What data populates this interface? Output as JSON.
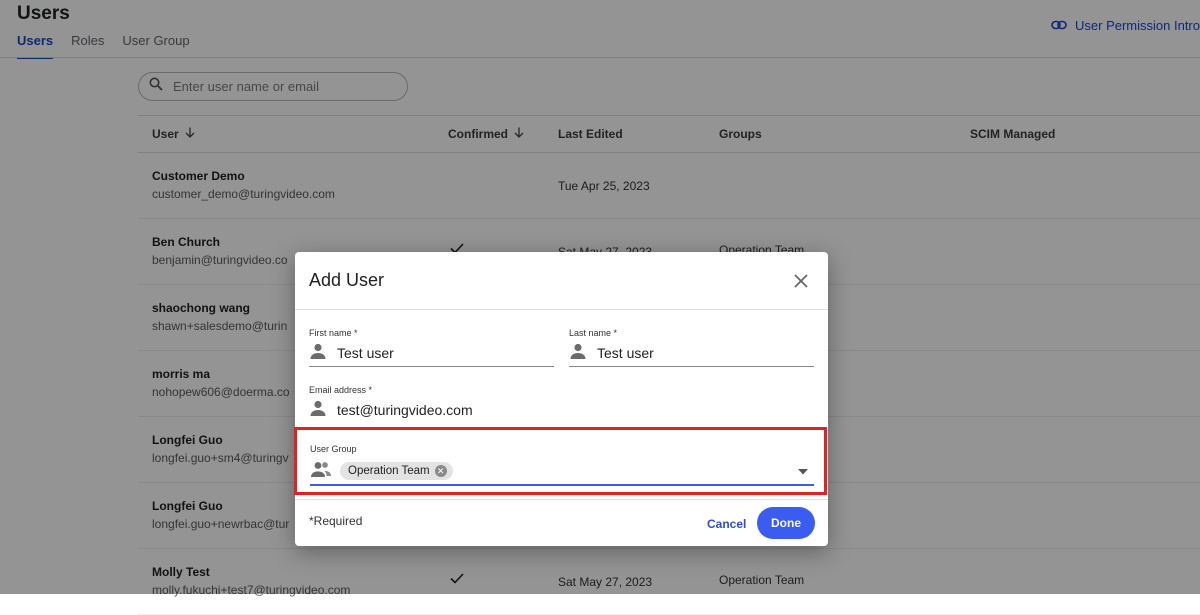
{
  "page": {
    "title": "Users",
    "tabs": [
      {
        "label": "Users",
        "active": true
      },
      {
        "label": "Roles",
        "active": false
      },
      {
        "label": "User Group",
        "active": false
      }
    ],
    "permission_link": "User Permission Intro",
    "link_icon": "link-icon"
  },
  "search": {
    "placeholder": "Enter user name or email",
    "icon": "search-icon"
  },
  "table": {
    "columns": [
      "User",
      "Confirmed",
      "Last Edited",
      "Groups",
      "SCIM Managed"
    ],
    "rows": [
      {
        "name": "Customer Demo",
        "email": "customer_demo@turingvideo.com",
        "confirmed": false,
        "last_edited": "Tue Apr 25, 2023",
        "groups": ""
      },
      {
        "name": "Ben Church",
        "email": "benjamin@turingvideo.co",
        "confirmed": true,
        "last_edited": "Sat May 27, 2023",
        "groups": "Operation Team"
      },
      {
        "name": "shaochong wang",
        "email": "shawn+salesdemo@turin",
        "confirmed": false,
        "last_edited": "",
        "groups": ""
      },
      {
        "name": "morris ma",
        "email": "nohopew606@doerma.co",
        "confirmed": false,
        "last_edited": "",
        "groups": ""
      },
      {
        "name": "Longfei Guo",
        "email": "longfei.guo+sm4@turingv",
        "confirmed": false,
        "last_edited": "",
        "groups": ""
      },
      {
        "name": "Longfei Guo",
        "email": "longfei.guo+newrbac@tur",
        "confirmed": false,
        "last_edited": "",
        "groups": ""
      },
      {
        "name": "Molly Test",
        "email": "molly.fukuchi+test7@turingvideo.com",
        "confirmed": true,
        "last_edited": "Sat May 27, 2023",
        "groups": "Operation Team"
      }
    ]
  },
  "dialog": {
    "title": "Add User",
    "first_name": {
      "label": "First name *",
      "value": "Test user"
    },
    "last_name": {
      "label": "Last name *",
      "value": "Test user"
    },
    "email": {
      "label": "Email address *",
      "value": "test@turingvideo.com"
    },
    "user_group": {
      "label": "User Group",
      "chips": [
        "Operation Team"
      ]
    },
    "required_note": "*Required",
    "cancel_label": "Cancel",
    "done_label": "Done",
    "colors": {
      "primary": "#3b5cf0",
      "highlight_border": "#e12222",
      "link": "#1a46c9"
    }
  }
}
